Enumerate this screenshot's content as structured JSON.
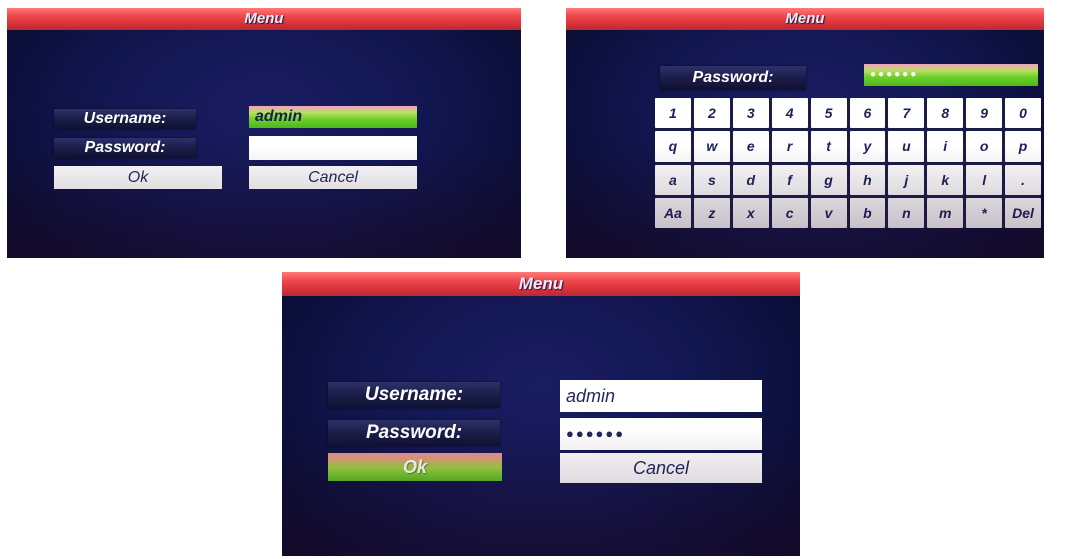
{
  "screen1": {
    "title": "Menu",
    "username_label": "Username:",
    "username_value": "admin",
    "password_label": "Password:",
    "password_value": "",
    "ok_label": "Ok",
    "cancel_label": "Cancel"
  },
  "screen2": {
    "title": "Menu",
    "password_label": "Password:",
    "password_value": "●●●●●●",
    "keys": [
      "1",
      "2",
      "3",
      "4",
      "5",
      "6",
      "7",
      "8",
      "9",
      "0",
      "q",
      "w",
      "e",
      "r",
      "t",
      "y",
      "u",
      "i",
      "o",
      "p",
      "a",
      "s",
      "d",
      "f",
      "g",
      "h",
      "j",
      "k",
      "l",
      ".",
      "Aa",
      "z",
      "x",
      "c",
      "v",
      "b",
      "n",
      "m",
      "*",
      "Del"
    ]
  },
  "screen3": {
    "title": "Menu",
    "username_label": "Username:",
    "username_value": "admin",
    "password_label": "Password:",
    "password_value": "●●●●●●",
    "ok_label": "Ok",
    "cancel_label": "Cancel"
  },
  "colors": {
    "titlebar": "#e0383f",
    "background": "#141858",
    "highlight_green": "#6cd02a",
    "field_white": "#ffffff"
  }
}
